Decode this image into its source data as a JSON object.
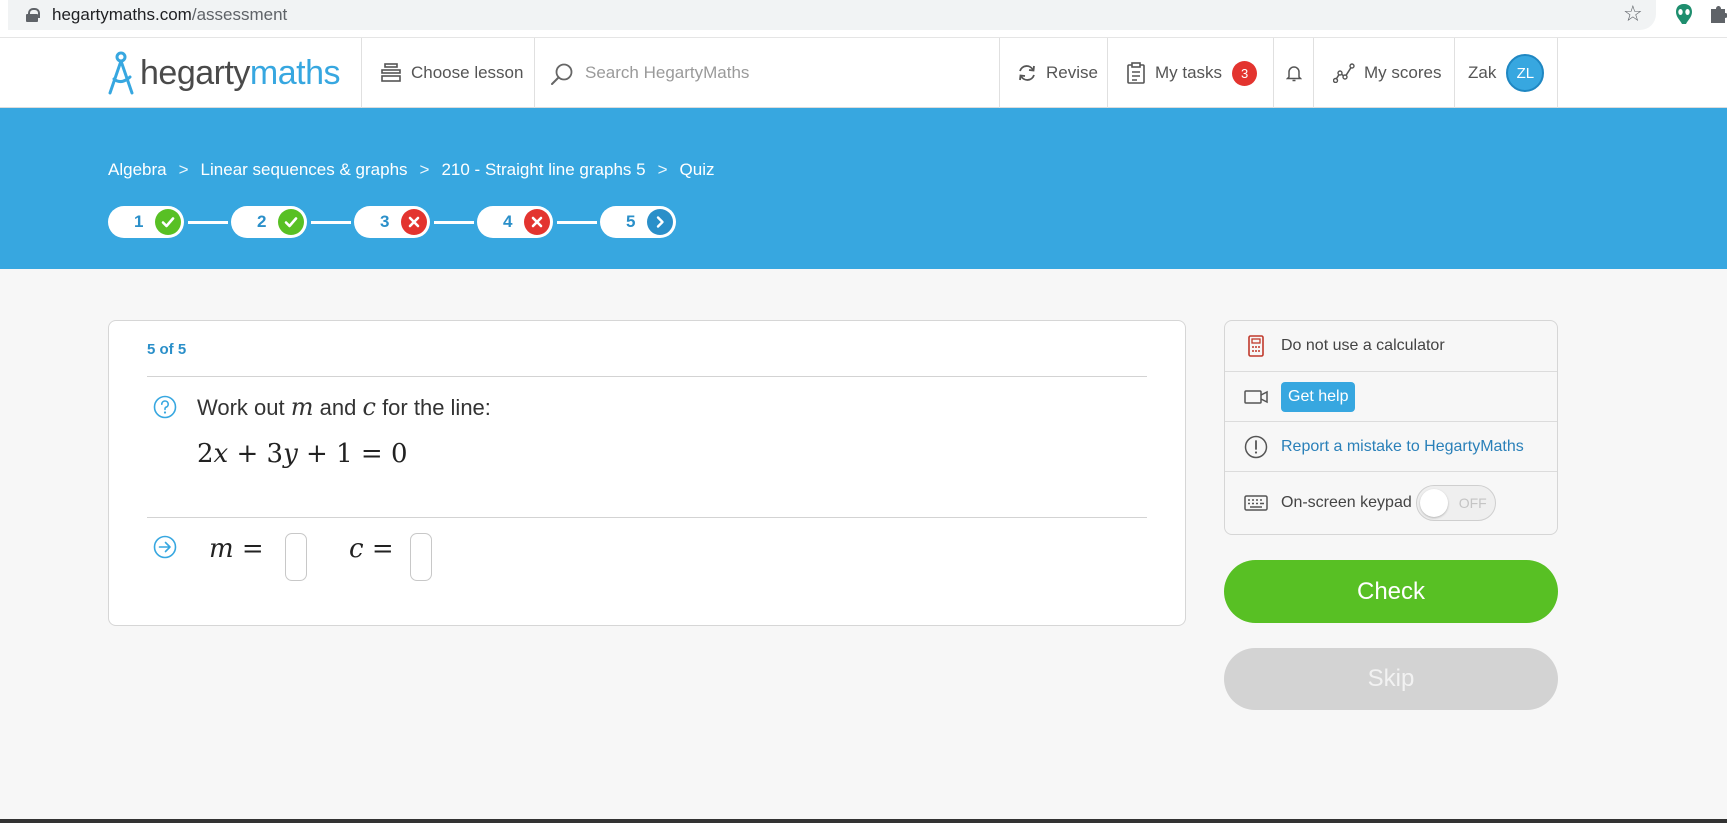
{
  "browser": {
    "url_host": "hegartymaths.com",
    "url_path": "/assessment"
  },
  "header": {
    "logo_part1": "hegarty",
    "logo_part2": "maths",
    "choose_lesson": "Choose lesson",
    "search_placeholder": "Search HegartyMaths",
    "revise": "Revise",
    "my_tasks": "My tasks",
    "tasks_count": "3",
    "my_scores": "My scores",
    "user_name": "Zak",
    "user_initials": "ZL"
  },
  "breadcrumb": {
    "items": [
      "Algebra",
      "Linear sequences & graphs",
      "210 - Straight line graphs 5",
      "Quiz"
    ],
    "separator": ">"
  },
  "steps": [
    {
      "number": "1",
      "status": "correct"
    },
    {
      "number": "2",
      "status": "correct"
    },
    {
      "number": "3",
      "status": "incorrect"
    },
    {
      "number": "4",
      "status": "incorrect"
    },
    {
      "number": "5",
      "status": "current"
    }
  ],
  "question": {
    "progress": "5 of 5",
    "prompt_prefix": "Work out",
    "var1": "m",
    "conj": "and",
    "var2": "c",
    "prompt_suffix": "for the line:",
    "equation": {
      "t1": "2",
      "v1": "x",
      "op1": " + ",
      "t2": "3",
      "v2": "y",
      "op2": " + ",
      "t3": "1",
      "eq": " = ",
      "rhs": "0"
    },
    "answer_m_label": "m",
    "answer_c_label": "c",
    "equals": "=",
    "answer_m_value": "",
    "answer_c_value": ""
  },
  "panel": {
    "calculator_note": "Do not use a calculator",
    "get_help": "Get help",
    "report": "Report a mistake to HegartyMaths",
    "keypad_label": "On-screen keypad",
    "keypad_state": "OFF"
  },
  "actions": {
    "check": "Check",
    "skip": "Skip"
  },
  "colors": {
    "brand_blue": "#37a7e0",
    "correct_green": "#58c024",
    "incorrect_red": "#e3342f",
    "link_blue": "#2a80b9"
  }
}
